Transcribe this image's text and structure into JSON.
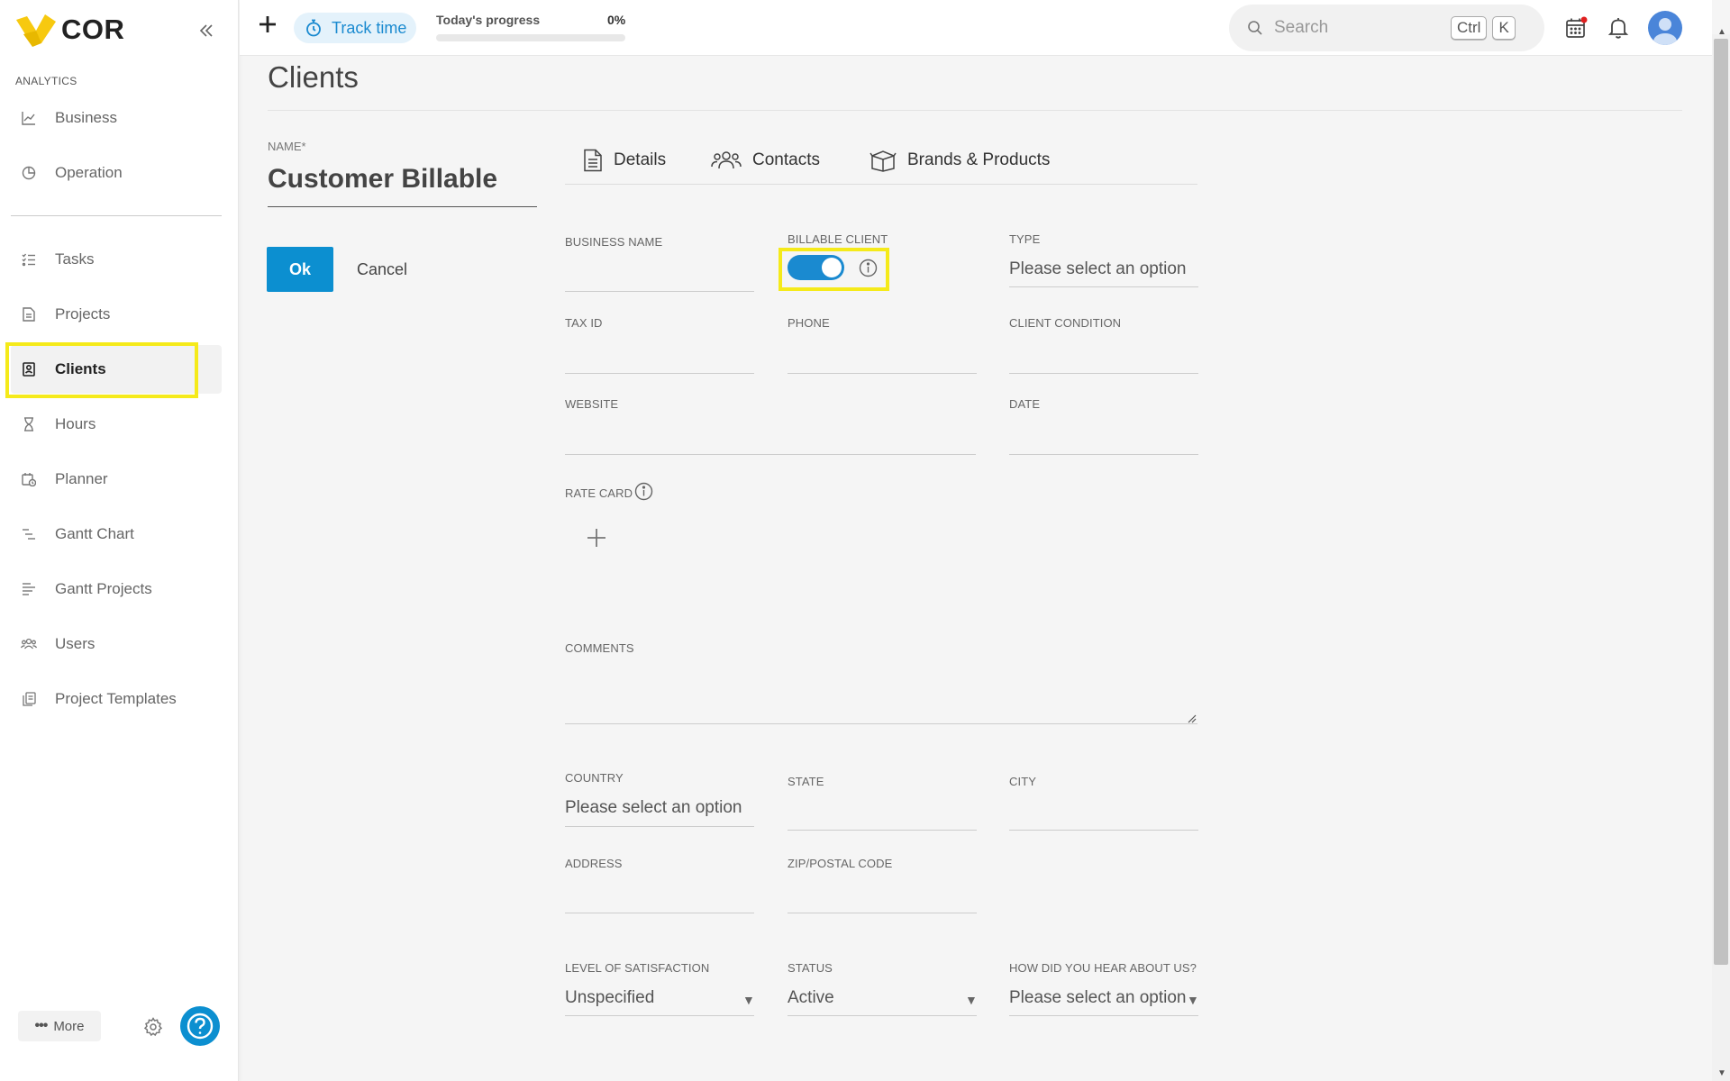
{
  "sidebar": {
    "brand": "COR",
    "section_label": "ANALYTICS",
    "analytics_items": [
      {
        "label": "Business",
        "icon": "chart-line-icon"
      },
      {
        "label": "Operation",
        "icon": "pie-chart-icon"
      }
    ],
    "items": [
      {
        "label": "Tasks",
        "icon": "task-list-icon"
      },
      {
        "label": "Projects",
        "icon": "document-icon"
      },
      {
        "label": "Clients",
        "icon": "contact-card-icon"
      },
      {
        "label": "Hours",
        "icon": "hourglass-icon"
      },
      {
        "label": "Planner",
        "icon": "calendar-clock-icon"
      },
      {
        "label": "Gantt Chart",
        "icon": "gantt-icon"
      },
      {
        "label": "Gantt Projects",
        "icon": "gantt-lines-icon"
      },
      {
        "label": "Users",
        "icon": "users-icon"
      },
      {
        "label": "Project Templates",
        "icon": "templates-icon"
      }
    ],
    "active_item": "Clients",
    "more_label": "More"
  },
  "topbar": {
    "track_time_label": "Track time",
    "progress_label": "Today's progress",
    "progress_value": "0%",
    "progress_fraction": 0,
    "search_placeholder": "Search",
    "shortcut_keys": [
      "Ctrl",
      "K"
    ]
  },
  "page": {
    "title": "Clients",
    "name_label": "NAME*",
    "name_value": "Customer Billable",
    "ok_label": "Ok",
    "cancel_label": "Cancel"
  },
  "tabs": [
    {
      "label": "Details",
      "icon": "document-icon"
    },
    {
      "label": "Contacts",
      "icon": "users-icon"
    },
    {
      "label": "Brands & Products",
      "icon": "box-icon"
    }
  ],
  "form": {
    "business_name_label": "BUSINESS NAME",
    "billable_client_label": "BILLABLE CLIENT",
    "billable_client_on": true,
    "type_label": "TYPE",
    "type_value": "Please select an option",
    "tax_id_label": "TAX ID",
    "phone_label": "PHONE",
    "client_condition_label": "CLIENT CONDITION",
    "website_label": "WEBSITE",
    "date_label": "DATE",
    "rate_card_label": "RATE CARD",
    "comments_label": "COMMENTS",
    "country_label": "COUNTRY",
    "country_value": "Please select an option",
    "state_label": "STATE",
    "city_label": "CITY",
    "address_label": "ADDRESS",
    "zip_label": "ZIP/POSTAL CODE",
    "satisfaction_label": "LEVEL OF SATISFACTION",
    "satisfaction_value": "Unspecified",
    "status_label": "STATUS",
    "status_value": "Active",
    "hear_label": "HOW DID YOU HEAR ABOUT US?",
    "hear_value": "Please select an option"
  },
  "colors": {
    "accent": "#1a8ad0",
    "highlight": "#f5ea1a",
    "logo": "#f7c90f"
  }
}
